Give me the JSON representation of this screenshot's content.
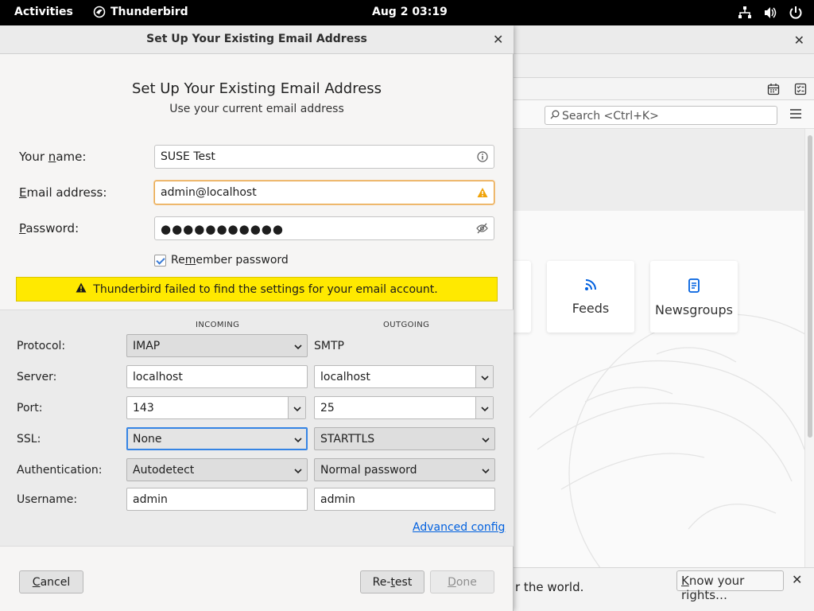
{
  "topbar": {
    "activities": "Activities",
    "app_name": "Thunderbird",
    "clock": "Aug 2  03:19"
  },
  "mainwin": {
    "search_placeholder": "Search <Ctrl+K>",
    "cards": [
      {
        "label": "Feeds",
        "icon": "rss-icon"
      },
      {
        "label": "Newsgroups",
        "icon": "newsgroup-icon"
      }
    ],
    "rights_text": "r the world.",
    "rights_button": "Know your rights…"
  },
  "dialog": {
    "window_title": "Set Up Your Existing Email Address",
    "heading": "Set Up Your Existing Email Address",
    "subheading": "Use your current email address",
    "name_label": "Your name:",
    "name_label_parts": [
      "Your ",
      "n",
      "ame:"
    ],
    "name_value": "SUSE Test",
    "email_label_parts": [
      "",
      "E",
      "mail address:"
    ],
    "email_value": "admin@localhost",
    "password_label_parts": [
      "",
      "P",
      "assword:"
    ],
    "password_dots": "●●●●●●●●●●●",
    "remember_parts": [
      "Re",
      "m",
      "ember password"
    ],
    "remember_checked": true,
    "warning": "Thunderbird failed to find the settings for your email account.",
    "colors": {
      "warning_bg": "#ffe900",
      "link": "#0060df",
      "focus": "#3584e4"
    }
  },
  "manual": {
    "incoming_header": "INCOMING",
    "outgoing_header": "OUTGOING",
    "labels": {
      "protocol": "Protocol:",
      "server": "Server:",
      "port": "Port:",
      "ssl": "SSL:",
      "authentication": "Authentication:",
      "username": "Username:"
    },
    "incoming": {
      "protocol": "IMAP",
      "server": "localhost",
      "port": "143",
      "ssl": "None",
      "authentication": "Autodetect",
      "username": "admin"
    },
    "outgoing": {
      "protocol": "SMTP",
      "server": "localhost",
      "port": "25",
      "ssl": "STARTTLS",
      "authentication": "Normal password",
      "username": "admin"
    },
    "advanced_config": "Advanced config"
  },
  "buttons": {
    "cancel_parts": [
      "",
      "C",
      "ancel"
    ],
    "retest_parts": [
      "Re-",
      "t",
      "est"
    ],
    "done_parts": [
      "",
      "D",
      "one"
    ]
  }
}
